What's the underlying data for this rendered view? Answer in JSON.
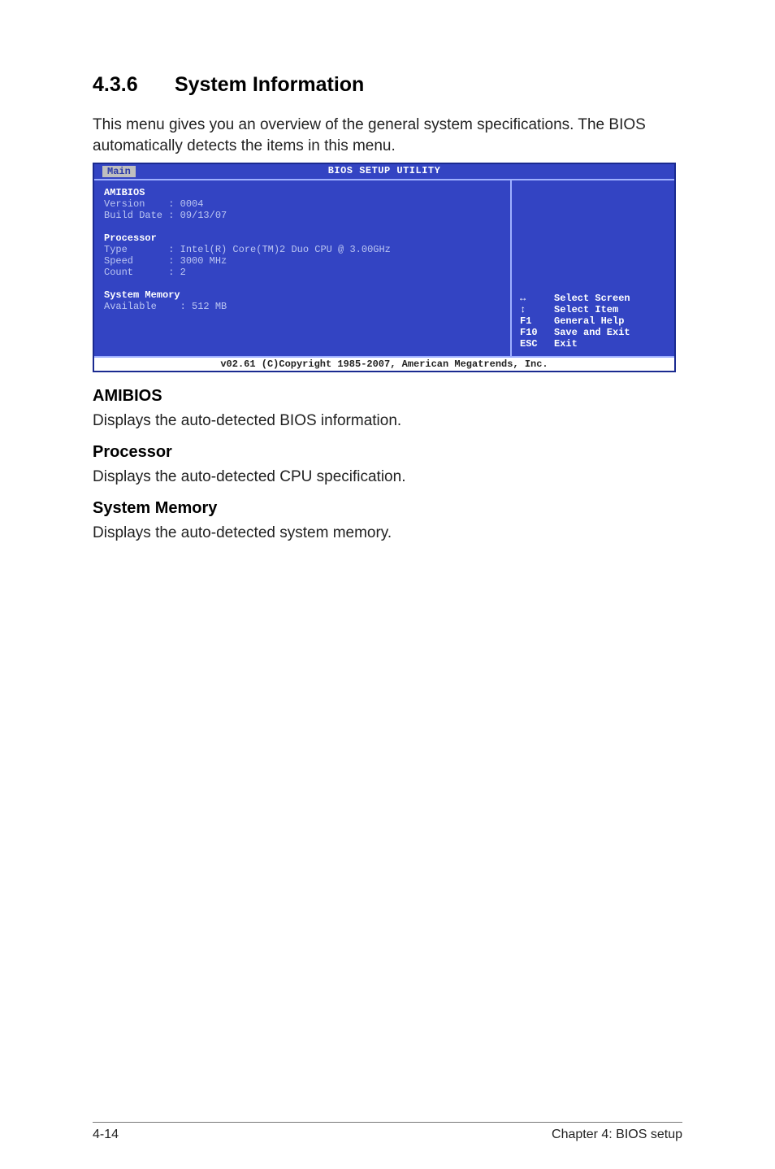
{
  "section": {
    "number": "4.3.6",
    "title": "System Information"
  },
  "intro1": "This menu gives you an overview of the general system specifications. The BIOS automatically detects the items in this menu.",
  "bios": {
    "title": "BIOS SETUP UTILITY",
    "tab": "Main",
    "amibios": {
      "header": "AMIBIOS",
      "version_label": "Version",
      "version_value": "0004",
      "build_label": "Build Date",
      "build_value": "09/13/07"
    },
    "processor": {
      "header": "Processor",
      "type_label": "Type",
      "type_value": "Intel(R) Core(TM)2 Duo CPU @ 3.00GHz",
      "speed_label": "Speed",
      "speed_value": "3000 MHz",
      "count_label": "Count",
      "count_value": "2"
    },
    "memory": {
      "header": "System Memory",
      "avail_label": "Available",
      "avail_value": "512 MB"
    },
    "help": [
      {
        "key_icon": "↔",
        "label": "Select Screen"
      },
      {
        "key_icon": "↕",
        "label": "Select Item"
      },
      {
        "key": "F1",
        "label": "General Help"
      },
      {
        "key": "F10",
        "label": "Save and Exit"
      },
      {
        "key": "ESC",
        "label": "Exit"
      }
    ],
    "footer": "v02.61 (C)Copyright 1985-2007, American Megatrends, Inc."
  },
  "sections": {
    "amibios": {
      "title": "AMIBIOS",
      "body": "Displays the auto-detected BIOS information."
    },
    "processor": {
      "title": "Processor",
      "body": "Displays the auto-detected CPU specification."
    },
    "memory": {
      "title": "System Memory",
      "body": "Displays the auto-detected system memory."
    }
  },
  "footer": {
    "left": "4-14",
    "right": "Chapter 4: BIOS setup"
  }
}
